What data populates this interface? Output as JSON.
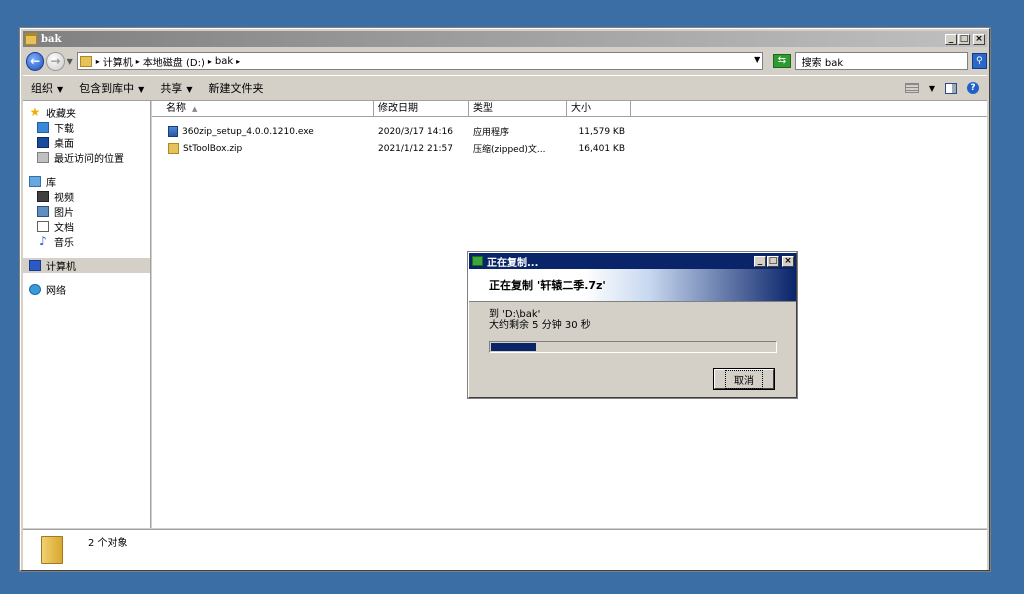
{
  "window": {
    "title": "bak"
  },
  "address": {
    "crumbs": [
      "计算机",
      "本地磁盘 (D:)",
      "bak"
    ],
    "search_placeholder": "搜索 bak"
  },
  "toolbar": {
    "organize": "组织",
    "include_library": "包含到库中",
    "share": "共享",
    "new_folder": "新建文件夹"
  },
  "nav": {
    "favorites": "收藏夹",
    "downloads": "下载",
    "desktop": "桌面",
    "recent": "最近访问的位置",
    "libraries": "库",
    "videos": "视频",
    "pictures": "图片",
    "documents": "文档",
    "music": "音乐",
    "computer": "计算机",
    "network": "网络"
  },
  "columns": {
    "name": "名称",
    "modified": "修改日期",
    "type": "类型",
    "size": "大小"
  },
  "files": [
    {
      "name": "360zip_setup_4.0.0.1210.exe",
      "modified": "2020/3/17 14:16",
      "type": "应用程序",
      "size": "11,579 KB"
    },
    {
      "name": "StToolBox.zip",
      "modified": "2021/1/12 21:57",
      "type": "压缩(zipped)文...",
      "size": "16,401 KB"
    }
  ],
  "status": {
    "count": "2 个对象"
  },
  "dialog": {
    "title": "正在复制...",
    "heading": "正在复制 '轩辕二季.7z'",
    "to": "到 'D:\\bak'",
    "remaining": "大约剩余 5 分钟 30 秒",
    "progress": 0.16,
    "cancel": "取消"
  }
}
